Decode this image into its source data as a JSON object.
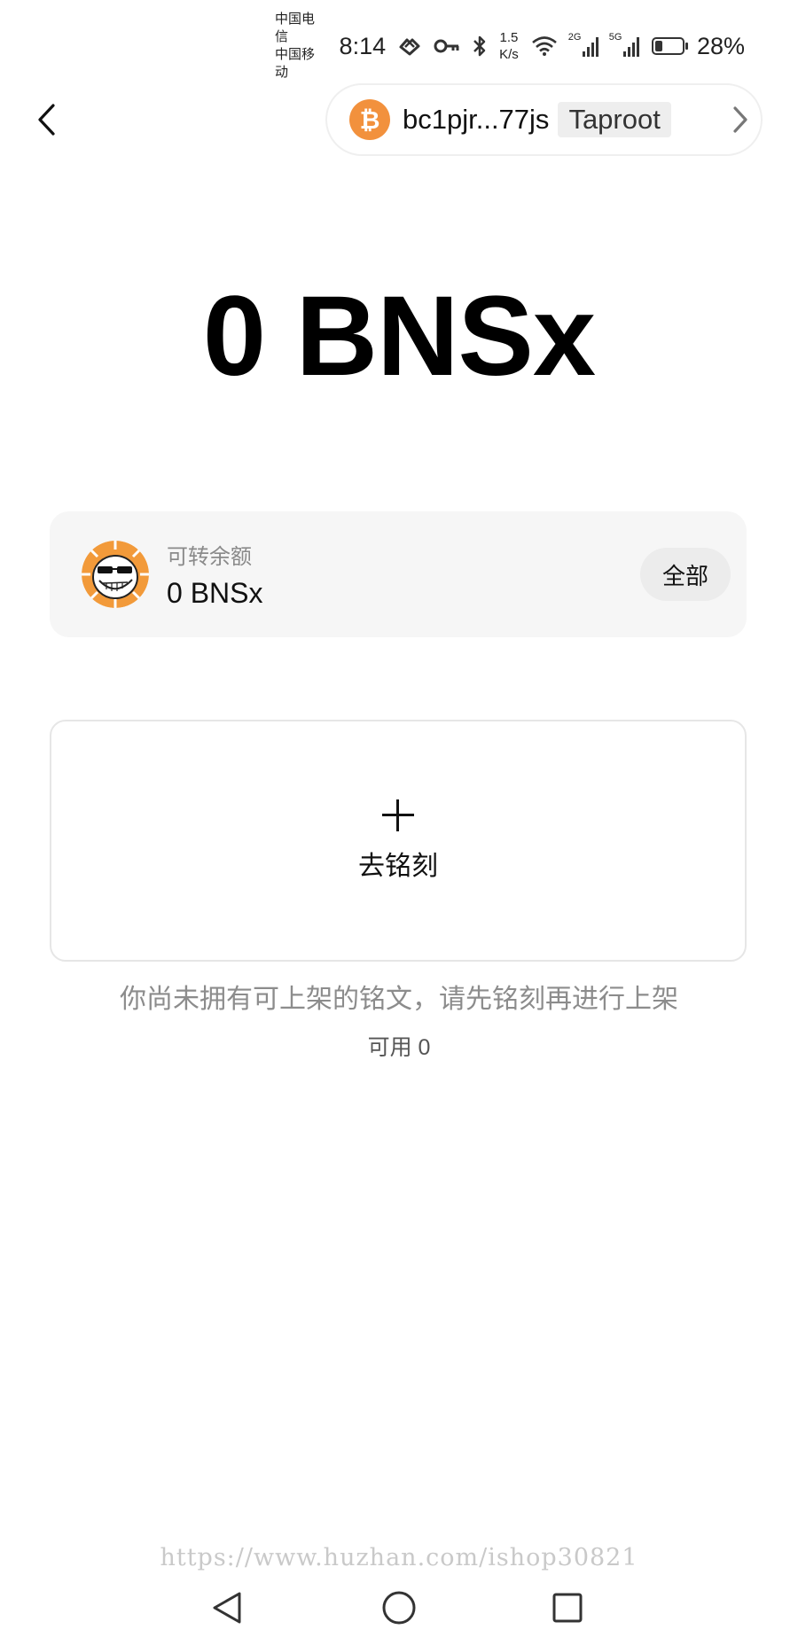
{
  "status_bar": {
    "carrier1": "中国电信",
    "carrier2": "中国移动",
    "time": "8:14",
    "speed_value": "1.5",
    "speed_unit": "K/s",
    "signal1_label": "2G",
    "signal2_label": "5G",
    "battery": "28%"
  },
  "header": {
    "address": "bc1pjr...77js",
    "address_type": "Taproot",
    "coin_icon": "₿"
  },
  "balance": {
    "big": "0 BNSx"
  },
  "transferable": {
    "label": "可转余额",
    "value": "0 BNSx",
    "all_button": "全部"
  },
  "inscribe": {
    "label": "去铭刻"
  },
  "hint": "你尚未拥有可上架的铭文，请先铭刻再进行上架",
  "available": "可用 0",
  "watermark": "https://www.huzhan.com/ishop30821",
  "colors": {
    "bitcoin": "#f2913d",
    "card_bg": "#f6f6f6"
  }
}
